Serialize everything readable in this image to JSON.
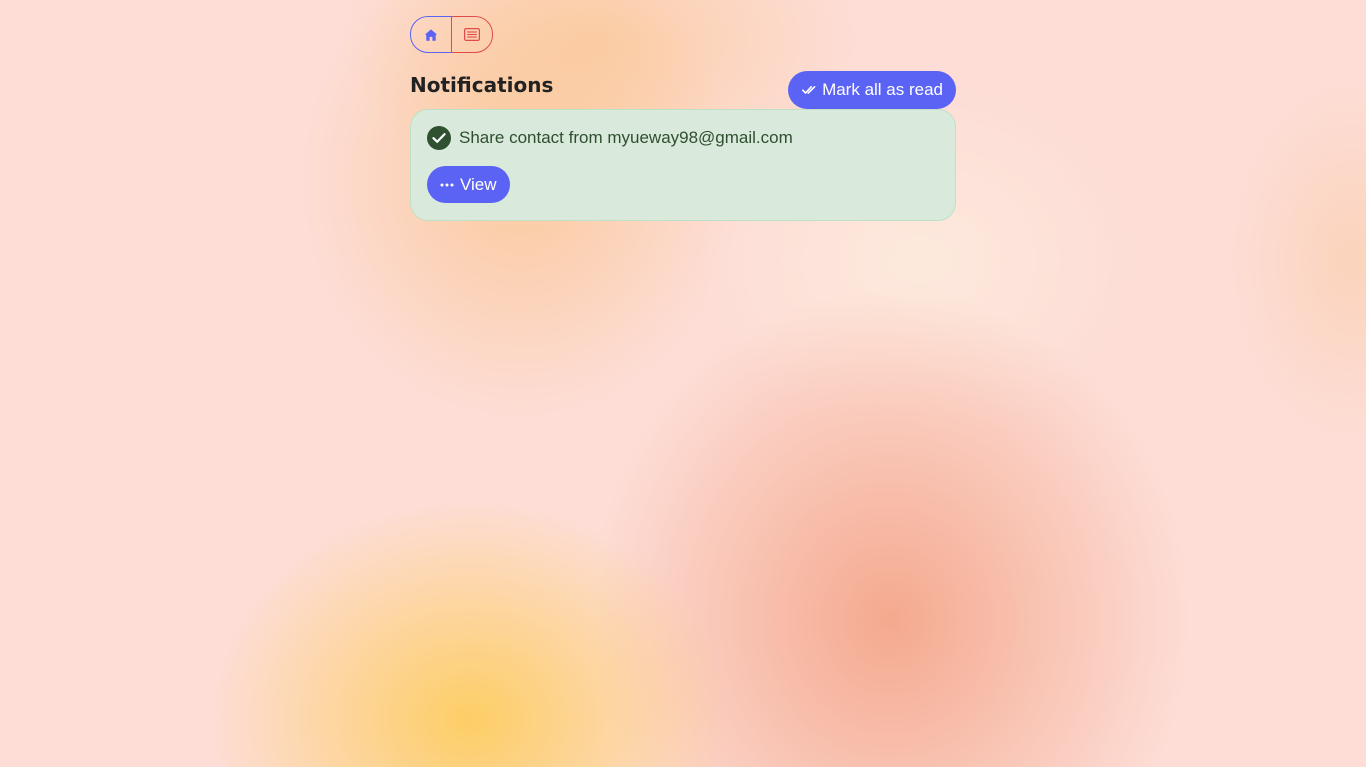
{
  "nav": {
    "home_icon": "home-icon",
    "list_icon": "list-icon"
  },
  "header": {
    "title": "Notifications",
    "mark_all_label": "Mark all as read",
    "mark_all_icon": "double-check-icon"
  },
  "notifications": [
    {
      "status_icon": "check-circle-icon",
      "text": "Share contact from myueway98@gmail.com",
      "action_label": "View",
      "action_icon": "more-horizontal-icon"
    }
  ],
  "colors": {
    "accent": "#5b63f5",
    "danger": "#e04a4a",
    "success_bg": "#d9eadc",
    "success_text": "#2f4f30"
  }
}
